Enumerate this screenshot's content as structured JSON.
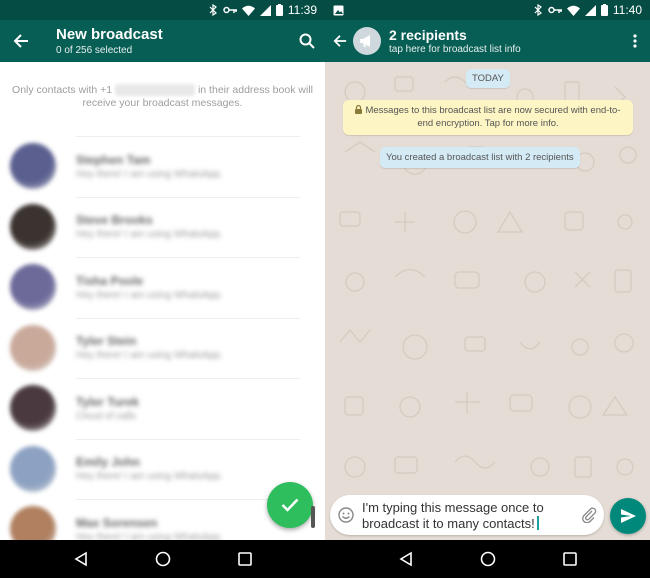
{
  "left": {
    "status_time": "11:39",
    "title": "New broadcast",
    "subtitle": "0 of 256 selected",
    "notice_prefix": "Only contacts with +1",
    "notice_suffix": "in their address book will receive your broadcast messages.",
    "contacts": [
      {
        "name": "Stephen Tam",
        "status": "Hey there! I am using WhatsApp.",
        "avatar_color": "#5a5f8f"
      },
      {
        "name": "Steve Brooks",
        "status": "Hey there! I am using WhatsApp.",
        "avatar_color": "#3b3330"
      },
      {
        "name": "Tisha Poole",
        "status": "Hey there! I am using WhatsApp.",
        "avatar_color": "#6d6a9a"
      },
      {
        "name": "Tyler Stein",
        "status": "Hey there! I am using WhatsApp.",
        "avatar_color": "#c9a99a"
      },
      {
        "name": "Tyler Turek",
        "status": "Cloud of calls",
        "avatar_color": "#4a3a3f"
      },
      {
        "name": "Emily John",
        "status": "Hey there! I am using WhatsApp.",
        "avatar_color": "#8da2c2"
      },
      {
        "name": "Max Sorensen",
        "status": "Hey there! I am using WhatsApp.",
        "avatar_color": "#b08060"
      }
    ]
  },
  "right": {
    "status_time": "11:40",
    "title": "2 recipients",
    "subtitle": "tap here for broadcast list info",
    "day_label": "TODAY",
    "encryption_notice": "Messages to this broadcast list are now secured with end-to-end encryption. Tap for more info.",
    "system_message": "You created a broadcast list with 2 recipients",
    "message_text": "I'm typing this message once to broadcast it to many contacts!"
  },
  "colors": {
    "primary": "#075e54",
    "statusbar": "#054d44",
    "fab": "#2fbe5e",
    "send": "#00897b",
    "chat_bg": "#e5ddd5"
  },
  "icons": [
    "arrow-back-icon",
    "search-icon",
    "check-icon",
    "megaphone-icon",
    "more-vert-icon",
    "lock-icon",
    "emoji-icon",
    "attach-icon",
    "send-icon",
    "nav-back-icon",
    "nav-home-icon",
    "nav-recents-icon"
  ]
}
